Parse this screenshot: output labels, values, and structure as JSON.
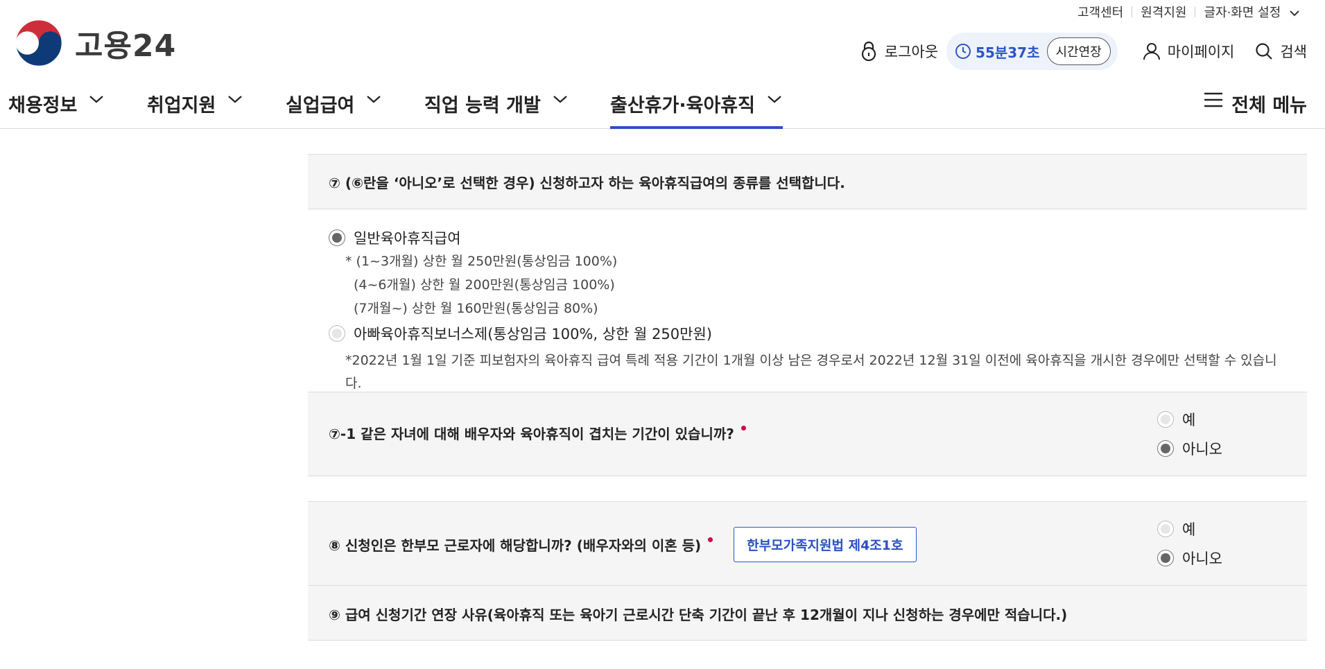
{
  "utility": {
    "items": [
      "고객센터",
      "원격지원",
      "글자·화면 설정"
    ]
  },
  "logo": {
    "text": "고용24"
  },
  "header": {
    "logout": "로그아웃",
    "timer": "55분37초",
    "extend": "시간연장",
    "mypage": "마이페이지",
    "search": "검색"
  },
  "gnb": {
    "items": [
      "채용정보",
      "취업지원",
      "실업급여",
      "직업 능력 개발",
      "출산휴가·육아휴직"
    ],
    "active_index": 4,
    "all_menu": "전체 메뉴"
  },
  "colors": {
    "accent": "#2b4fc4",
    "required": "#d1003f"
  },
  "q7": {
    "title": "⑦ (⑥란을 ‘아니오’로 선택한 경우) 신청하고자 하는 육아휴직급여의 종류를 선택합니다.",
    "option1": {
      "label": "일반육아휴직급여",
      "checked": true,
      "notes": [
        "* (1~3개월) 상한 월 250만원(통상임금 100%)",
        "(4~6개월) 상한 월 200만원(통상임금 100%)",
        "(7개월~) 상한 월 160만원(통상임금 80%)"
      ]
    },
    "option2": {
      "label": "아빠육아휴직보너스제(통상임금 100%, 상한 월 250만원)",
      "checked": false,
      "note": "*2022년 1월 1일 기준 피보험자의 육아휴직 급여 특례 적용 기간이 1개월 이상 남은 경우로서 2022년 12월 31일 이전에 육아휴직을 개시한 경우에만 선택할 수 있습니다."
    }
  },
  "q7_1": {
    "title": "⑦-1 같은 자녀에 대해 배우자와 육아휴직이 겹치는 기간이 있습니까?",
    "yes": "예",
    "no": "아니오",
    "selected": "아니오"
  },
  "q8": {
    "title": "⑧ 신청인은 한부모 근로자에 해당합니까? (배우자와의 이혼 등)",
    "law_button": "한부모가족지원법 제4조1호",
    "yes": "예",
    "no": "아니오",
    "selected": "아니오"
  },
  "q9": {
    "title": "⑨ 급여 신청기간 연장 사유(육아휴직 또는 육아기 근로시간 단축 기간이 끝난 후 12개월이 지나 신청하는 경우에만 적습니다.)"
  }
}
